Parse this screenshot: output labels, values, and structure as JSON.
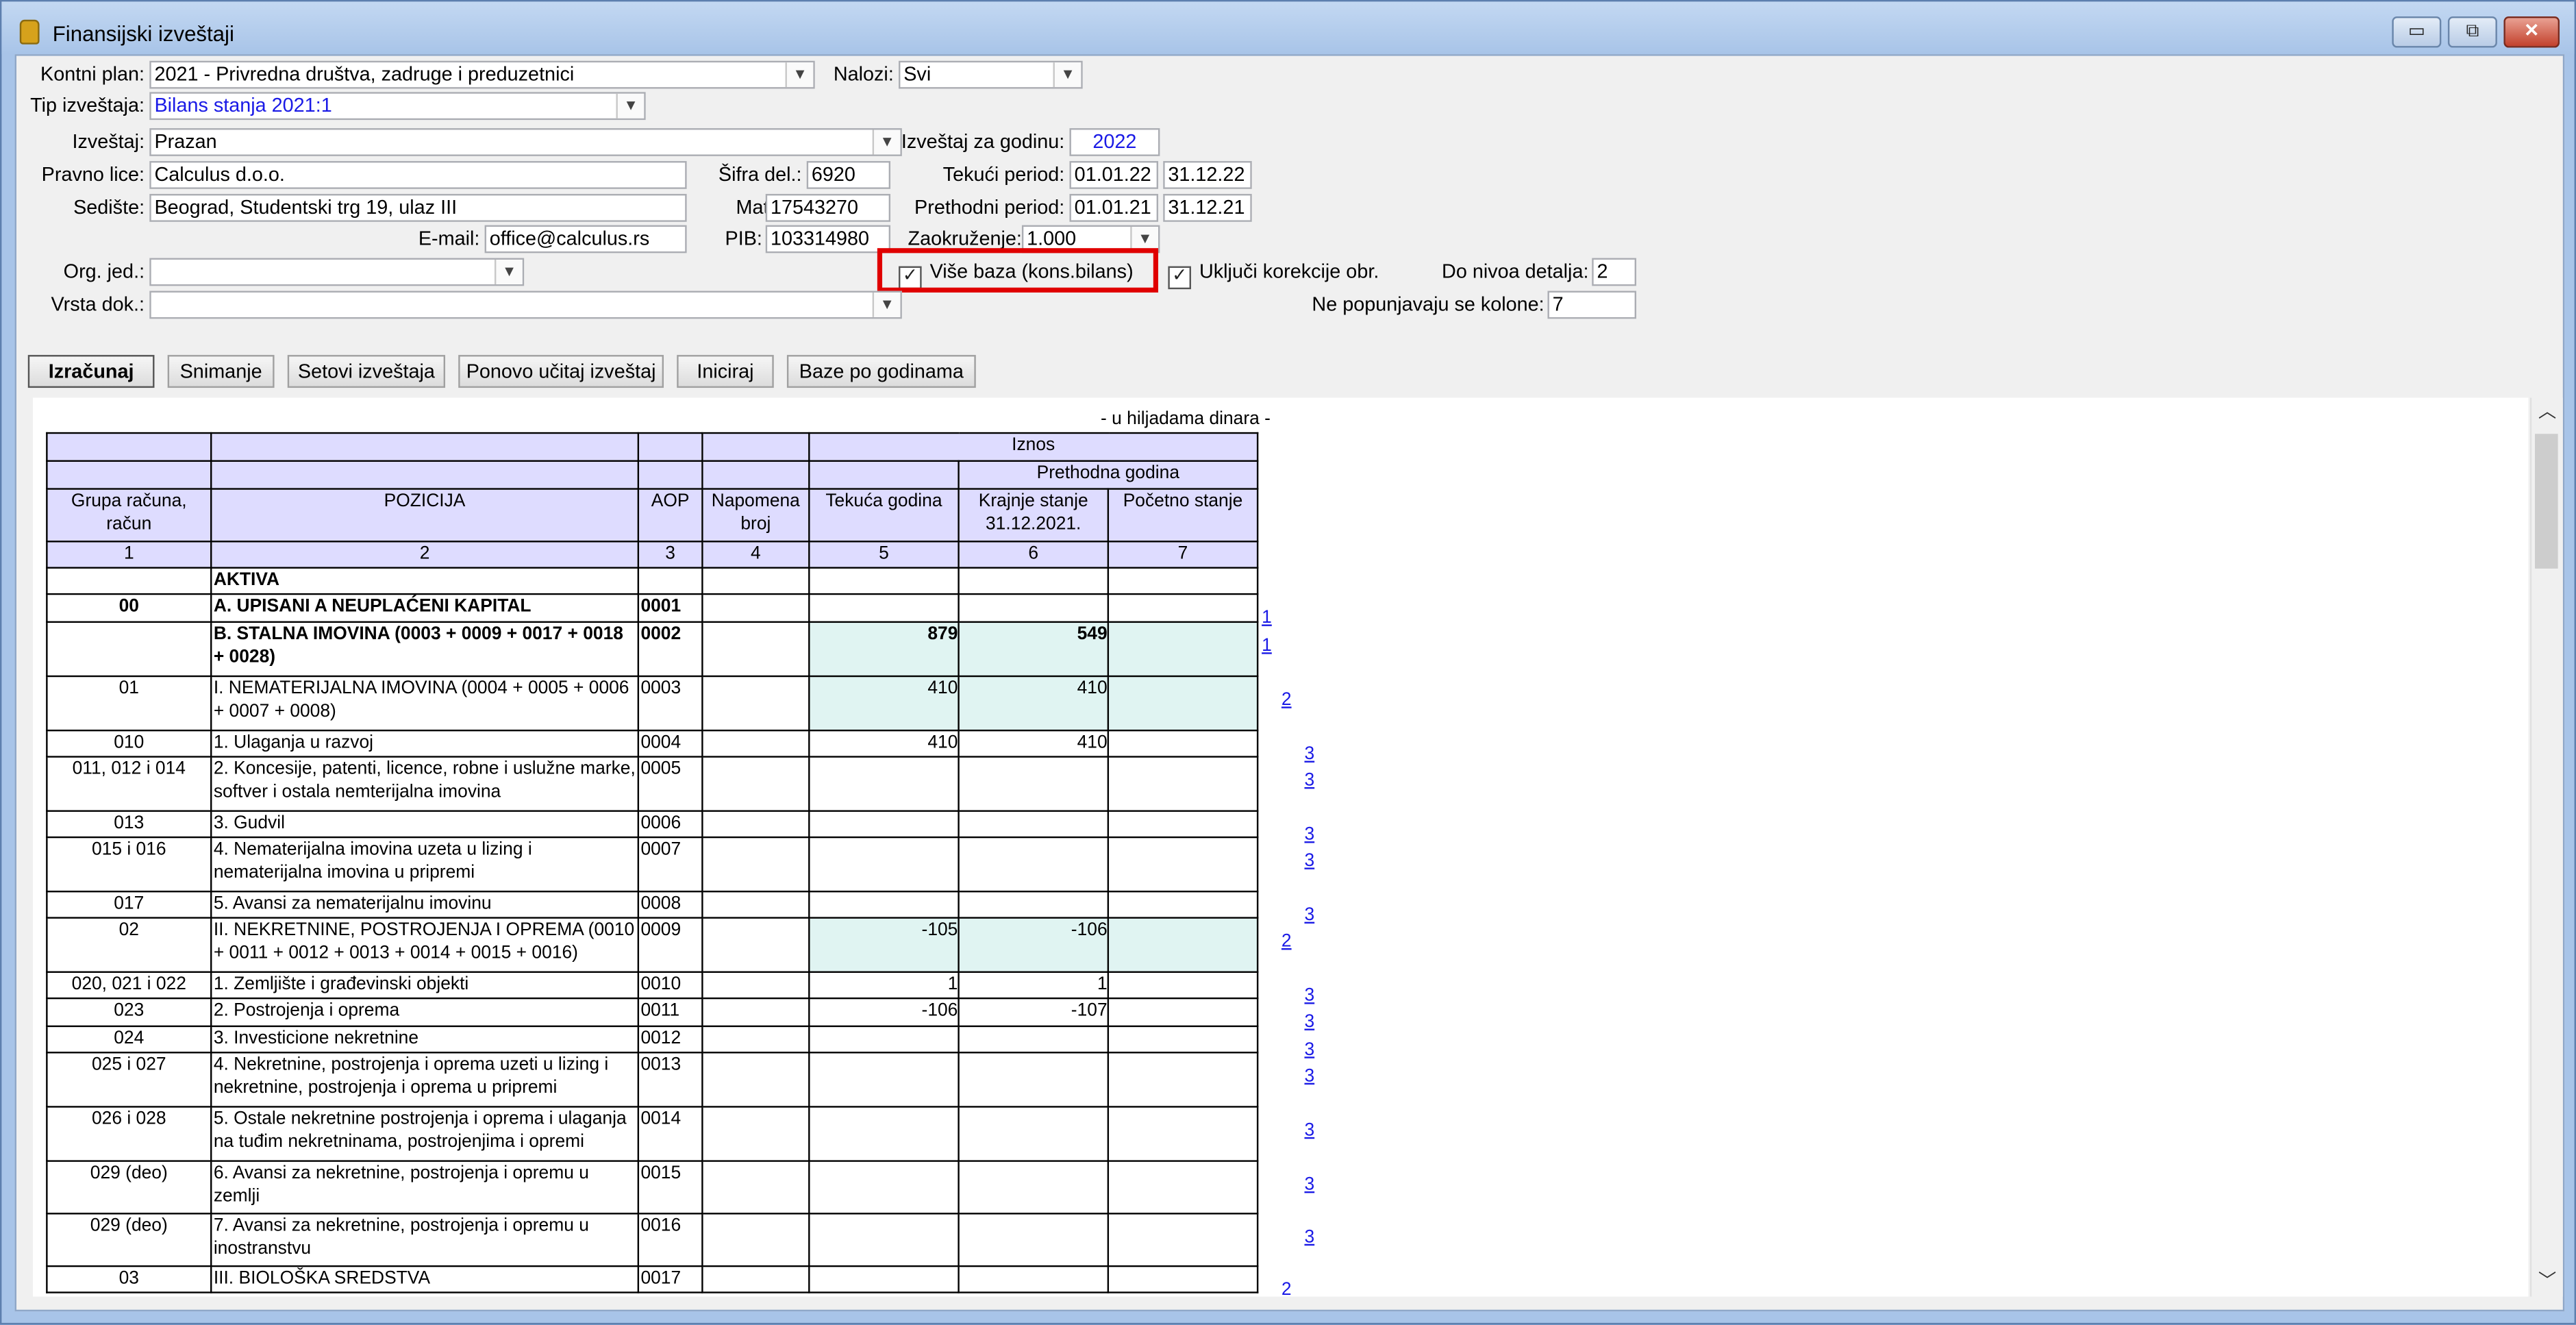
{
  "window": {
    "title": "Finansijski izveštaji",
    "buttons": {
      "minimize": "▭",
      "maximize": "⧉",
      "close": "✕"
    }
  },
  "form": {
    "kontni_plan": {
      "label": "Kontni plan:",
      "value": "2021 - Privredna društva, zadruge i preduzetnici"
    },
    "nalozi": {
      "label": "Nalozi:",
      "value": "Svi"
    },
    "tip_izvestaja": {
      "label": "Tip izveštaja:",
      "value": "Bilans stanja 2021:1"
    },
    "izvestaj": {
      "label": "Izveštaj:",
      "value": "Prazan"
    },
    "izvestaj_za_godinu": {
      "label": "Izveštaj za godinu:",
      "value": "2022"
    },
    "pravno_lice": {
      "label": "Pravno lice:",
      "value": "Calculus d.o.o."
    },
    "sifra_del": {
      "label": "Šifra del.:",
      "value": "6920"
    },
    "tekuci_period": {
      "label": "Tekući period:",
      "from": "01.01.22",
      "to": "31.12.22"
    },
    "sediste": {
      "label": "Sedište:",
      "value": "Beograd, Studentski trg 19, ulaz III"
    },
    "mat_br": {
      "label": "Mat.br.:",
      "value": "17543270"
    },
    "prethodni_period": {
      "label": "Prethodni period:",
      "from": "01.01.21",
      "to": "31.12.21"
    },
    "email": {
      "label": "E-mail:",
      "value": "office@calculus.rs"
    },
    "pib": {
      "label": "PIB:",
      "value": "103314980"
    },
    "zaokruzenje": {
      "label": "Zaokruženje:",
      "value": "1.000"
    },
    "org_jed": {
      "label": "Org. jed.:",
      "value": ""
    },
    "vise_baza": {
      "label": "Više baza (kons.bilans)",
      "checked": true
    },
    "ukljuci_korekcije": {
      "label": "Uključi korekcije obr.",
      "checked": true
    },
    "do_nivoa_detalja": {
      "label": "Do nivoa detalja:",
      "value": "2"
    },
    "vrsta_dok": {
      "label": "Vrsta dok.:",
      "value": ""
    },
    "ne_popunjavaju": {
      "label": "Ne popunjavaju se kolone:",
      "value": "7"
    }
  },
  "toolbar": {
    "izracunaj": "Izračunaj",
    "snimanje": "Snimanje",
    "setovi": "Setovi izveštaja",
    "ponovo": "Ponovo učitaj izveštaj",
    "iniciraj": "Iniciraj",
    "baze": "Baze po godinama"
  },
  "report": {
    "unit_note": "- u hiljadama dinara -",
    "headers": {
      "iznos": "Iznos",
      "prethodna_godina": "Prethodna godina",
      "grupa": "Grupa računa, račun",
      "pozicija": "POZICIJA",
      "aop": "AOP",
      "napomena": "Napomena broj",
      "tekuca": "Tekuća godina",
      "krajnje": "Krajnje stanje 31.12.2021.",
      "pocetno": "Početno stanje",
      "nums": [
        "1",
        "2",
        "3",
        "4",
        "5",
        "6",
        "7"
      ]
    },
    "rows": [
      {
        "grupa": "",
        "pozicija": "AKTIVA",
        "aop": "",
        "napomena": "",
        "tekuca": "",
        "krajnje": "",
        "pocetno": "",
        "link": ""
      },
      {
        "grupa": "00",
        "pozicija": "A. UPISANI A NEUPLAĆENI KAPITAL",
        "aop": "0001",
        "napomena": "",
        "tekuca": "",
        "krajnje": "",
        "pocetno": "",
        "link": "1"
      },
      {
        "grupa": "",
        "pozicija": "B. STALNA IMOVINA (0003 + 0009 + 0017 + 0018 + 0028)",
        "aop": "0002",
        "napomena": "",
        "tekuca": "879",
        "krajnje": "549",
        "pocetno": "",
        "link": "1"
      },
      {
        "grupa": "01",
        "pozicija": "I. NEMATERIJALNA IMOVINA (0004 + 0005 + 0006 + 0007 + 0008)",
        "aop": "0003",
        "napomena": "",
        "tekuca": "410",
        "krajnje": "410",
        "pocetno": "",
        "link": "2"
      },
      {
        "grupa": "010",
        "pozicija": "1. Ulaganja u razvoj",
        "aop": "0004",
        "napomena": "",
        "tekuca": "410",
        "krajnje": "410",
        "pocetno": "",
        "link": "3"
      },
      {
        "grupa": "011, 012 i 014",
        "pozicija": "2. Koncesije, patenti, licence, robne i uslužne marke, softver i ostala nemterijalna imovina",
        "aop": "0005",
        "napomena": "",
        "tekuca": "",
        "krajnje": "",
        "pocetno": "",
        "link": "3"
      },
      {
        "grupa": "013",
        "pozicija": "3. Gudvil",
        "aop": "0006",
        "napomena": "",
        "tekuca": "",
        "krajnje": "",
        "pocetno": "",
        "link": "3"
      },
      {
        "grupa": "015 i 016",
        "pozicija": "4. Nematerijalna imovina uzeta u lizing i nematerijalna imovina u pripremi",
        "aop": "0007",
        "napomena": "",
        "tekuca": "",
        "krajnje": "",
        "pocetno": "",
        "link": "3"
      },
      {
        "grupa": "017",
        "pozicija": "5. Avansi za nematerijalnu imovinu",
        "aop": "0008",
        "napomena": "",
        "tekuca": "",
        "krajnje": "",
        "pocetno": "",
        "link": "3"
      },
      {
        "grupa": "02",
        "pozicija": "II. NEKRETNINE, POSTROJENJA I OPREMA (0010 + 0011 + 0012 + 0013 + 0014 + 0015 + 0016)",
        "aop": "0009",
        "napomena": "",
        "tekuca": "-105",
        "krajnje": "-106",
        "pocetno": "",
        "link": "2"
      },
      {
        "grupa": "020, 021 i 022",
        "pozicija": "1. Zemljište i građevinski objekti",
        "aop": "0010",
        "napomena": "",
        "tekuca": "1",
        "krajnje": "1",
        "pocetno": "",
        "link": "3"
      },
      {
        "grupa": "023",
        "pozicija": "2. Postrojenja i oprema",
        "aop": "0011",
        "napomena": "",
        "tekuca": "-106",
        "krajnje": "-107",
        "pocetno": "",
        "link": "3"
      },
      {
        "grupa": "024",
        "pozicija": "3. Investicione nekretnine",
        "aop": "0012",
        "napomena": "",
        "tekuca": "",
        "krajnje": "",
        "pocetno": "",
        "link": "3"
      },
      {
        "grupa": "025 i 027",
        "pozicija": "4. Nekretnine, postrojenja i oprema uzeti u lizing i nekretnine, postrojenja i oprema u pripremi",
        "aop": "0013",
        "napomena": "",
        "tekuca": "",
        "krajnje": "",
        "pocetno": "",
        "link": "3"
      },
      {
        "grupa": "026 i 028",
        "pozicija": "5. Ostale nekretnine postrojenja i oprema i ulaganja na tuđim nekretninama, postrojenjima i opremi",
        "aop": "0014",
        "napomena": "",
        "tekuca": "",
        "krajnje": "",
        "pocetno": "",
        "link": "3"
      },
      {
        "grupa": "029 (deo)",
        "pozicija": "6. Avansi za nekretnine, postrojenja i opremu u zemlji",
        "aop": "0015",
        "napomena": "",
        "tekuca": "",
        "krajnje": "",
        "pocetno": "",
        "link": "3"
      },
      {
        "grupa": "029 (deo)",
        "pozicija": "7. Avansi za nekretnine, postrojenja i opremu u inostranstvu",
        "aop": "0016",
        "napomena": "",
        "tekuca": "",
        "krajnje": "",
        "pocetno": "",
        "link": "3"
      },
      {
        "grupa": "03",
        "pozicija": "III. BIOLOŠKA SREDSTVA",
        "aop": "0017",
        "napomena": "",
        "tekuca": "",
        "krajnje": "",
        "pocetno": "",
        "link": "2"
      }
    ]
  }
}
